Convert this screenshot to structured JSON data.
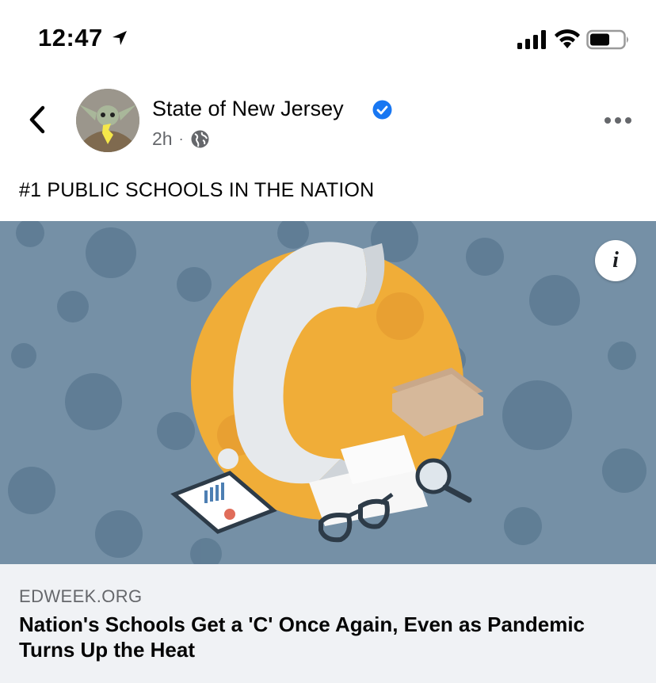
{
  "status_bar": {
    "time": "12:47",
    "icons": [
      "location-arrow-icon",
      "cellular-signal-icon",
      "wifi-icon",
      "battery-icon"
    ]
  },
  "post": {
    "author": "State of New Jersey",
    "verified": true,
    "timestamp": "2h",
    "separator": "·",
    "audience_icon": "globe-icon",
    "text": "#1 PUBLIC SCHOOLS IN THE NATION"
  },
  "link_preview": {
    "domain": "EDWEEK.ORG",
    "headline": "Nation's Schools Get a 'C' Once Again, Even as Pandemic Turns Up the Heat",
    "info_label": "i"
  },
  "colors": {
    "verified_blue": "#1877f2",
    "image_background": "#7590a6",
    "orange_circle": "#f0ad38",
    "footer_background": "#f0f2f5",
    "secondary_text": "#65676b"
  }
}
